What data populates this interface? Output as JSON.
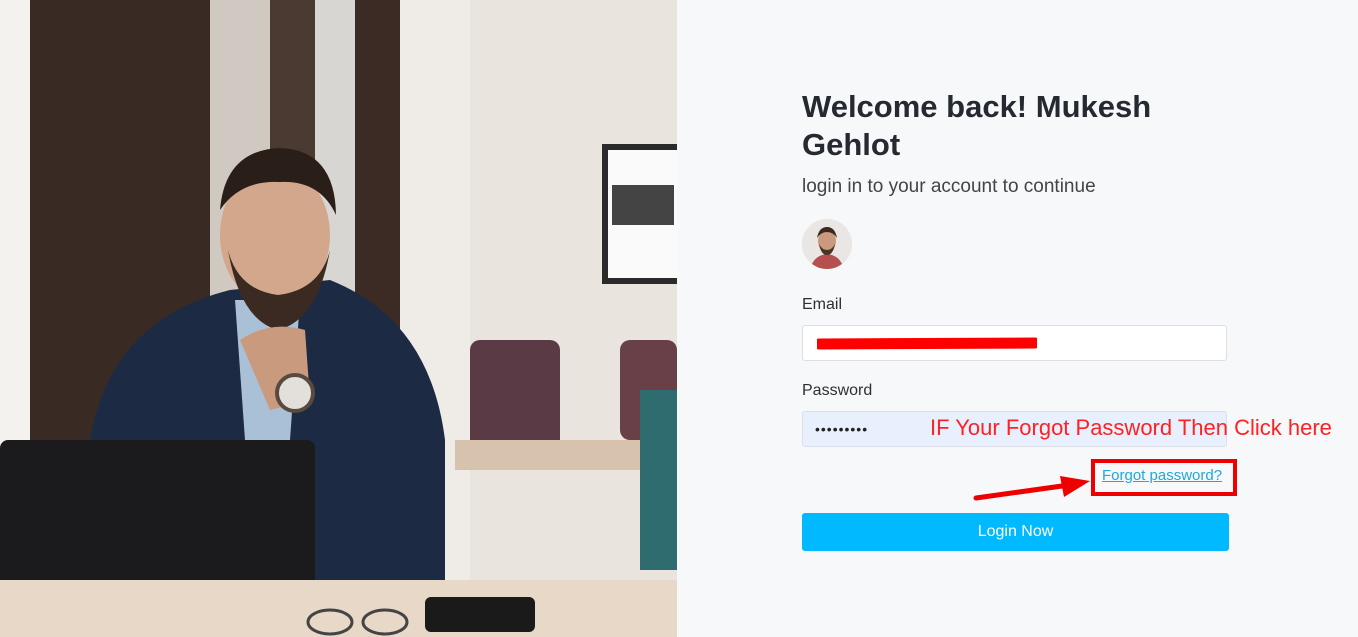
{
  "page": {
    "title": "Welcome back! Mukesh Gehlot",
    "subtitle": "login in to your account to continue"
  },
  "form": {
    "email_label": "Email",
    "email_value": "",
    "password_label": "Password",
    "password_value": "•••••••••",
    "forgot_link": "Forgot password?",
    "login_button": "Login Now"
  },
  "annotation": {
    "text": "IF Your Forgot Password Then Click here",
    "color": "#ff2222"
  },
  "colors": {
    "accent": "#00b9ff",
    "link": "#20a7dd",
    "highlight_box": "#ee0000"
  },
  "icons": {
    "avatar": "user-avatar-photo",
    "arrow": "red-arrow-right"
  }
}
